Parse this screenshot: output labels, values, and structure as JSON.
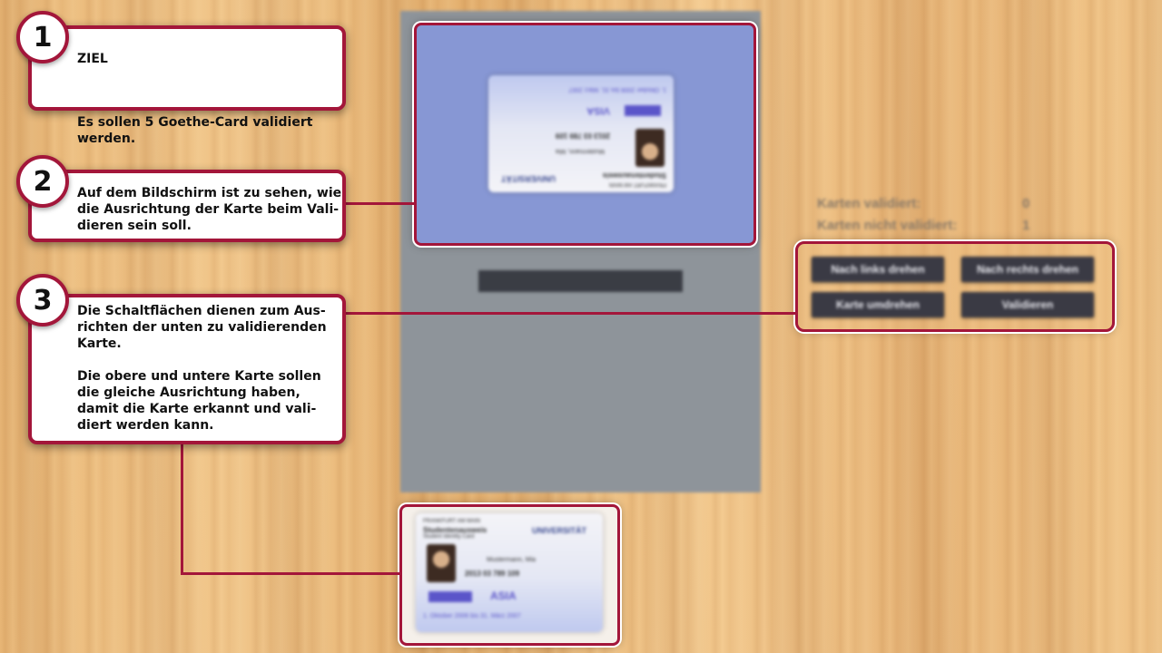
{
  "game": {
    "stats": {
      "validated_label": "Karten validiert:",
      "validated_value": "0",
      "not_validated_label": "Karten nicht validiert:",
      "not_validated_value": "1"
    },
    "buttons": {
      "rotate_left": "Nach links drehen",
      "rotate_right": "Nach rechts drehen",
      "flip": "Karte umdrehen",
      "validate": "Validieren"
    }
  },
  "card": {
    "university": "UNIVERSITÄT",
    "university_sub": "FRANKFURT AM MAIN",
    "studentenausweis": "Studentenausweis",
    "student_identity_card": "Student Identity Card",
    "name": "Mustermann, Mia",
    "number": "2013 03 789 109",
    "asia": "ASIA",
    "visa": "VISA",
    "validity": "1. Oktober 2006 bis 31. März 2007"
  },
  "tutorial": {
    "step1": {
      "number": "1",
      "title": "ZIEL",
      "text": "Es sollen 5 Goethe-Card validiert\nwerden."
    },
    "step2": {
      "number": "2",
      "text": "Auf dem Bildschirm ist zu sehen, wie\ndie Ausrichtung der Karte beim Vali-\ndieren sein soll."
    },
    "step3": {
      "number": "3",
      "text": "Die Schaltflächen dienen zum Aus-\nrichten der unten zu validierenden\nKarte.\n\nDie obere und untere Karte sollen\ndie gleiche Ausrichtung haben,\ndamit die Karte erkannt und vali-\ndiert werden kann."
    }
  }
}
